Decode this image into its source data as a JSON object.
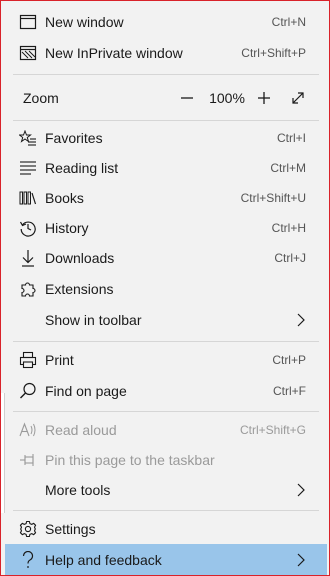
{
  "menu": {
    "new_window": {
      "label": "New window",
      "shortcut": "Ctrl+N",
      "icon": "window-icon"
    },
    "new_inprivate": {
      "label": "New InPrivate window",
      "shortcut": "Ctrl+Shift+P",
      "icon": "inprivate-icon"
    },
    "zoom": {
      "label": "Zoom",
      "value": "100%",
      "icon_out": "minus-icon",
      "icon_in": "plus-icon",
      "icon_full": "fullscreen-icon"
    },
    "favorites": {
      "label": "Favorites",
      "shortcut": "Ctrl+I",
      "icon": "star-list-icon"
    },
    "reading_list": {
      "label": "Reading list",
      "shortcut": "Ctrl+M",
      "icon": "reading-list-icon"
    },
    "books": {
      "label": "Books",
      "shortcut": "Ctrl+Shift+U",
      "icon": "books-icon"
    },
    "history": {
      "label": "History",
      "shortcut": "Ctrl+H",
      "icon": "history-icon"
    },
    "downloads": {
      "label": "Downloads",
      "shortcut": "Ctrl+J",
      "icon": "download-icon"
    },
    "extensions": {
      "label": "Extensions",
      "icon": "puzzle-icon"
    },
    "show_in_toolbar": {
      "label": "Show in toolbar",
      "icon": "chevron-right-icon"
    },
    "print": {
      "label": "Print",
      "shortcut": "Ctrl+P",
      "icon": "printer-icon"
    },
    "find_on_page": {
      "label": "Find on page",
      "shortcut": "Ctrl+F",
      "icon": "search-icon"
    },
    "read_aloud": {
      "label": "Read aloud",
      "shortcut": "Ctrl+Shift+G",
      "icon": "read-aloud-icon",
      "disabled": true
    },
    "pin_taskbar": {
      "label": "Pin this page to the taskbar",
      "icon": "pin-icon",
      "disabled": true
    },
    "more_tools": {
      "label": "More tools",
      "icon": "chevron-right-icon"
    },
    "settings": {
      "label": "Settings",
      "icon": "gear-icon"
    },
    "help_feedback": {
      "label": "Help and feedback",
      "icon": "question-icon",
      "highlighted": true
    }
  },
  "colors": {
    "border": "#d9222a",
    "menu_bg": "#f2f2f2",
    "highlight": "#99c5ea",
    "text": "#1a1a1a",
    "disabled_text": "#9a9a9a"
  }
}
